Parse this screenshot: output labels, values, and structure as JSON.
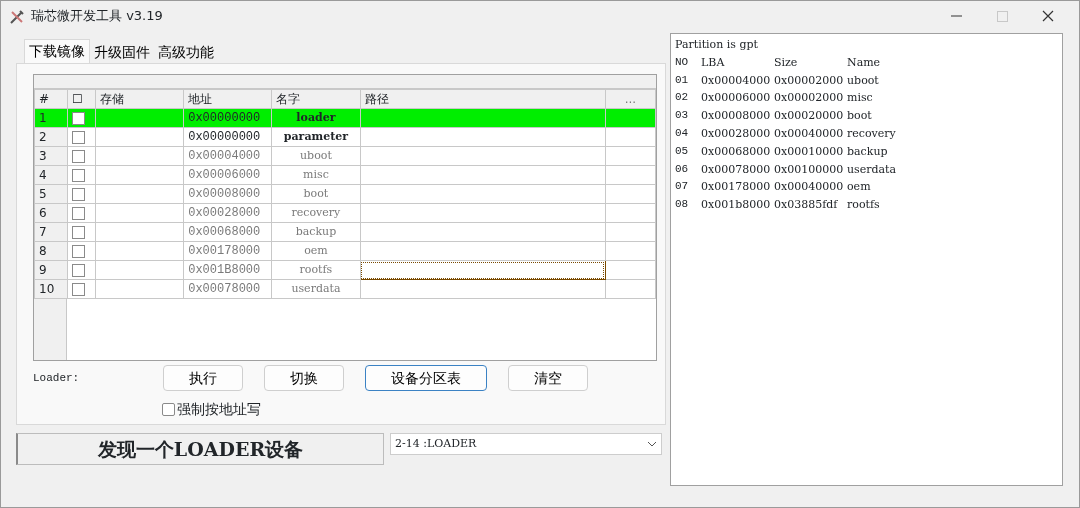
{
  "window": {
    "title": "瑞芯微开发工具 v3.19",
    "maximize_disabled": true
  },
  "tabs": [
    {
      "label": "下载镜像",
      "selected": true
    },
    {
      "label": "升级固件",
      "selected": false
    },
    {
      "label": "高级功能",
      "selected": false
    }
  ],
  "table": {
    "columns": [
      "#",
      "☐",
      "存储",
      "地址",
      "名字",
      "路径",
      "..."
    ],
    "rows": [
      {
        "no": "1",
        "checked": false,
        "address": "0x00000000",
        "name": "loader",
        "selected": true,
        "dimmed": false,
        "focused": false
      },
      {
        "no": "2",
        "checked": false,
        "address": "0x00000000",
        "name": "parameter",
        "selected": false,
        "dimmed": false,
        "focused": false
      },
      {
        "no": "3",
        "checked": false,
        "address": "0x00004000",
        "name": "uboot",
        "selected": false,
        "dimmed": true,
        "focused": false
      },
      {
        "no": "4",
        "checked": false,
        "address": "0x00006000",
        "name": "misc",
        "selected": false,
        "dimmed": true,
        "focused": false
      },
      {
        "no": "5",
        "checked": false,
        "address": "0x00008000",
        "name": "boot",
        "selected": false,
        "dimmed": true,
        "focused": false
      },
      {
        "no": "6",
        "checked": false,
        "address": "0x00028000",
        "name": "recovery",
        "selected": false,
        "dimmed": true,
        "focused": false
      },
      {
        "no": "7",
        "checked": false,
        "address": "0x00068000",
        "name": "backup",
        "selected": false,
        "dimmed": true,
        "focused": false
      },
      {
        "no": "8",
        "checked": false,
        "address": "0x00178000",
        "name": "oem",
        "selected": false,
        "dimmed": true,
        "focused": false
      },
      {
        "no": "9",
        "checked": false,
        "address": "0x001B8000",
        "name": "rootfs",
        "selected": false,
        "dimmed": true,
        "focused": true
      },
      {
        "no": "10",
        "checked": false,
        "address": "0x00078000",
        "name": "userdata",
        "selected": false,
        "dimmed": true,
        "focused": false
      }
    ]
  },
  "loader_label": "Loader:",
  "buttons": [
    {
      "label": "执行",
      "focused": false
    },
    {
      "label": "切换",
      "focused": false
    },
    {
      "label": "设备分区表",
      "focused": true
    },
    {
      "label": "清空",
      "focused": false
    }
  ],
  "force_address_write": {
    "label": "强制按地址写",
    "checked": false
  },
  "status": "发现一个LOADER设备",
  "device_select": {
    "value": "2-14 :LOADER"
  },
  "log": {
    "header": "Partition is gpt",
    "columns": [
      "NO",
      "LBA",
      "Size",
      "Name"
    ],
    "rows": [
      [
        "01",
        "0x00004000",
        "0x00002000",
        "uboot"
      ],
      [
        "02",
        "0x00006000",
        "0x00002000",
        "misc"
      ],
      [
        "03",
        "0x00008000",
        "0x00020000",
        "boot"
      ],
      [
        "04",
        "0x00028000",
        "0x00040000",
        "recovery"
      ],
      [
        "05",
        "0x00068000",
        "0x00010000",
        "backup"
      ],
      [
        "06",
        "0x00078000",
        "0x00100000",
        "userdata"
      ],
      [
        "07",
        "0x00178000",
        "0x00040000",
        "oem"
      ],
      [
        "08",
        "0x001b8000",
        "0x03885fdf",
        "rootfs"
      ]
    ]
  }
}
